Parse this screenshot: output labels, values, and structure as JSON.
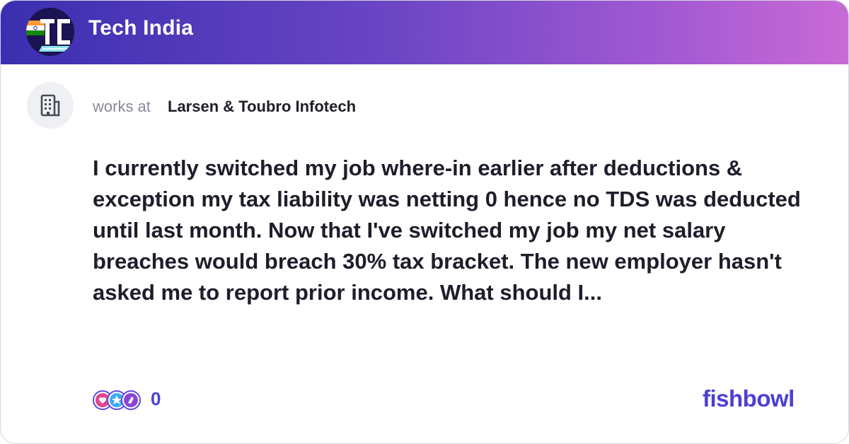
{
  "header": {
    "title": "Tech India"
  },
  "post": {
    "works_at_label": "works at",
    "company": "Larsen & Toubro Infotech",
    "body": "I currently switched my job where-in earlier after deductions & exception my tax liability was netting 0 hence no TDS was deducted until last month. Now that I've switched my job my net salary breaches would breach 30% tax bracket. The new employer hasn't asked me to report prior income. What should I..."
  },
  "footer": {
    "reaction_count": "0",
    "brand": "fishbowl"
  },
  "colors": {
    "header_gradient_start": "#3a2fb0",
    "header_gradient_end": "#c96ad6",
    "accent": "#4b3fd6",
    "text_primary": "#1d1d2b",
    "text_muted": "#8a8a98"
  },
  "icons": {
    "bowl_logo": "tech-india-bowl-logo",
    "avatar": "office-building-icon",
    "reactions": [
      "reaction-heart-icon",
      "reaction-star-icon",
      "reaction-clap-icon"
    ]
  }
}
